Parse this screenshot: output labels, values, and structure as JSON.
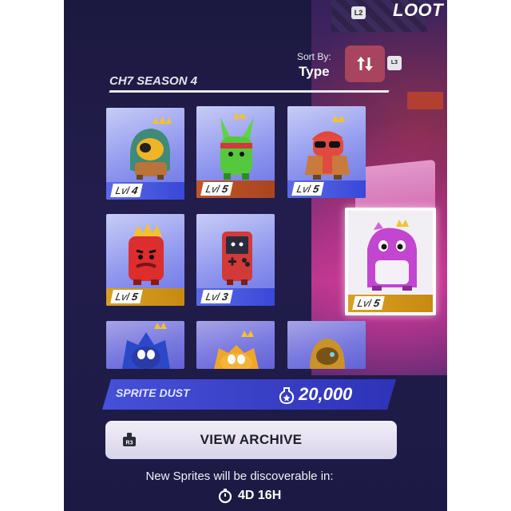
{
  "header": {
    "loot_title": "LOOT",
    "shoulder_button": "L2"
  },
  "sort": {
    "label": "Sort By:",
    "value": "Type",
    "stick_badge": "L3",
    "icon": "sort-arrows-icon"
  },
  "section": {
    "title": "CH7 SEASON 4"
  },
  "sprites": [
    {
      "level_prefix": "Lvl",
      "level": "4",
      "character": "hooded-eyepatch-sprite",
      "rarity_color": "#3848d8"
    },
    {
      "level_prefix": "Lvl",
      "level": "5",
      "character": "green-bunny-sprite",
      "rarity_color": "#a9451f"
    },
    {
      "level_prefix": "Lvl",
      "level": "5",
      "character": "red-sunglasses-sprite",
      "rarity_color": "#3848d8"
    },
    {
      "level_prefix": "Lvl",
      "level": "5",
      "character": "red-king-sprite",
      "rarity_color": "#c78a12"
    },
    {
      "level_prefix": "Lvl",
      "level": "3",
      "character": "handheld-console-sprite",
      "rarity_color": "#3848d8"
    },
    {
      "level_prefix": "Lvl",
      "level": "5",
      "character": "purple-dino-sprite",
      "rarity_color": "#c78a12"
    },
    {
      "character": "blue-hedgehog-sprite"
    },
    {
      "character": "orange-fox-sprite"
    },
    {
      "character": "golden-hooded-sprite"
    }
  ],
  "currency": {
    "label": "SPRITE DUST",
    "amount": "20,000",
    "icon": "sprite-dust-icon"
  },
  "archive": {
    "button_label": "VIEW ARCHIVE",
    "stick_badge": "R3"
  },
  "footer": {
    "discover_text": "New Sprites will be discoverable in:",
    "timer": "4D 16H",
    "timer_icon": "stopwatch-icon"
  }
}
